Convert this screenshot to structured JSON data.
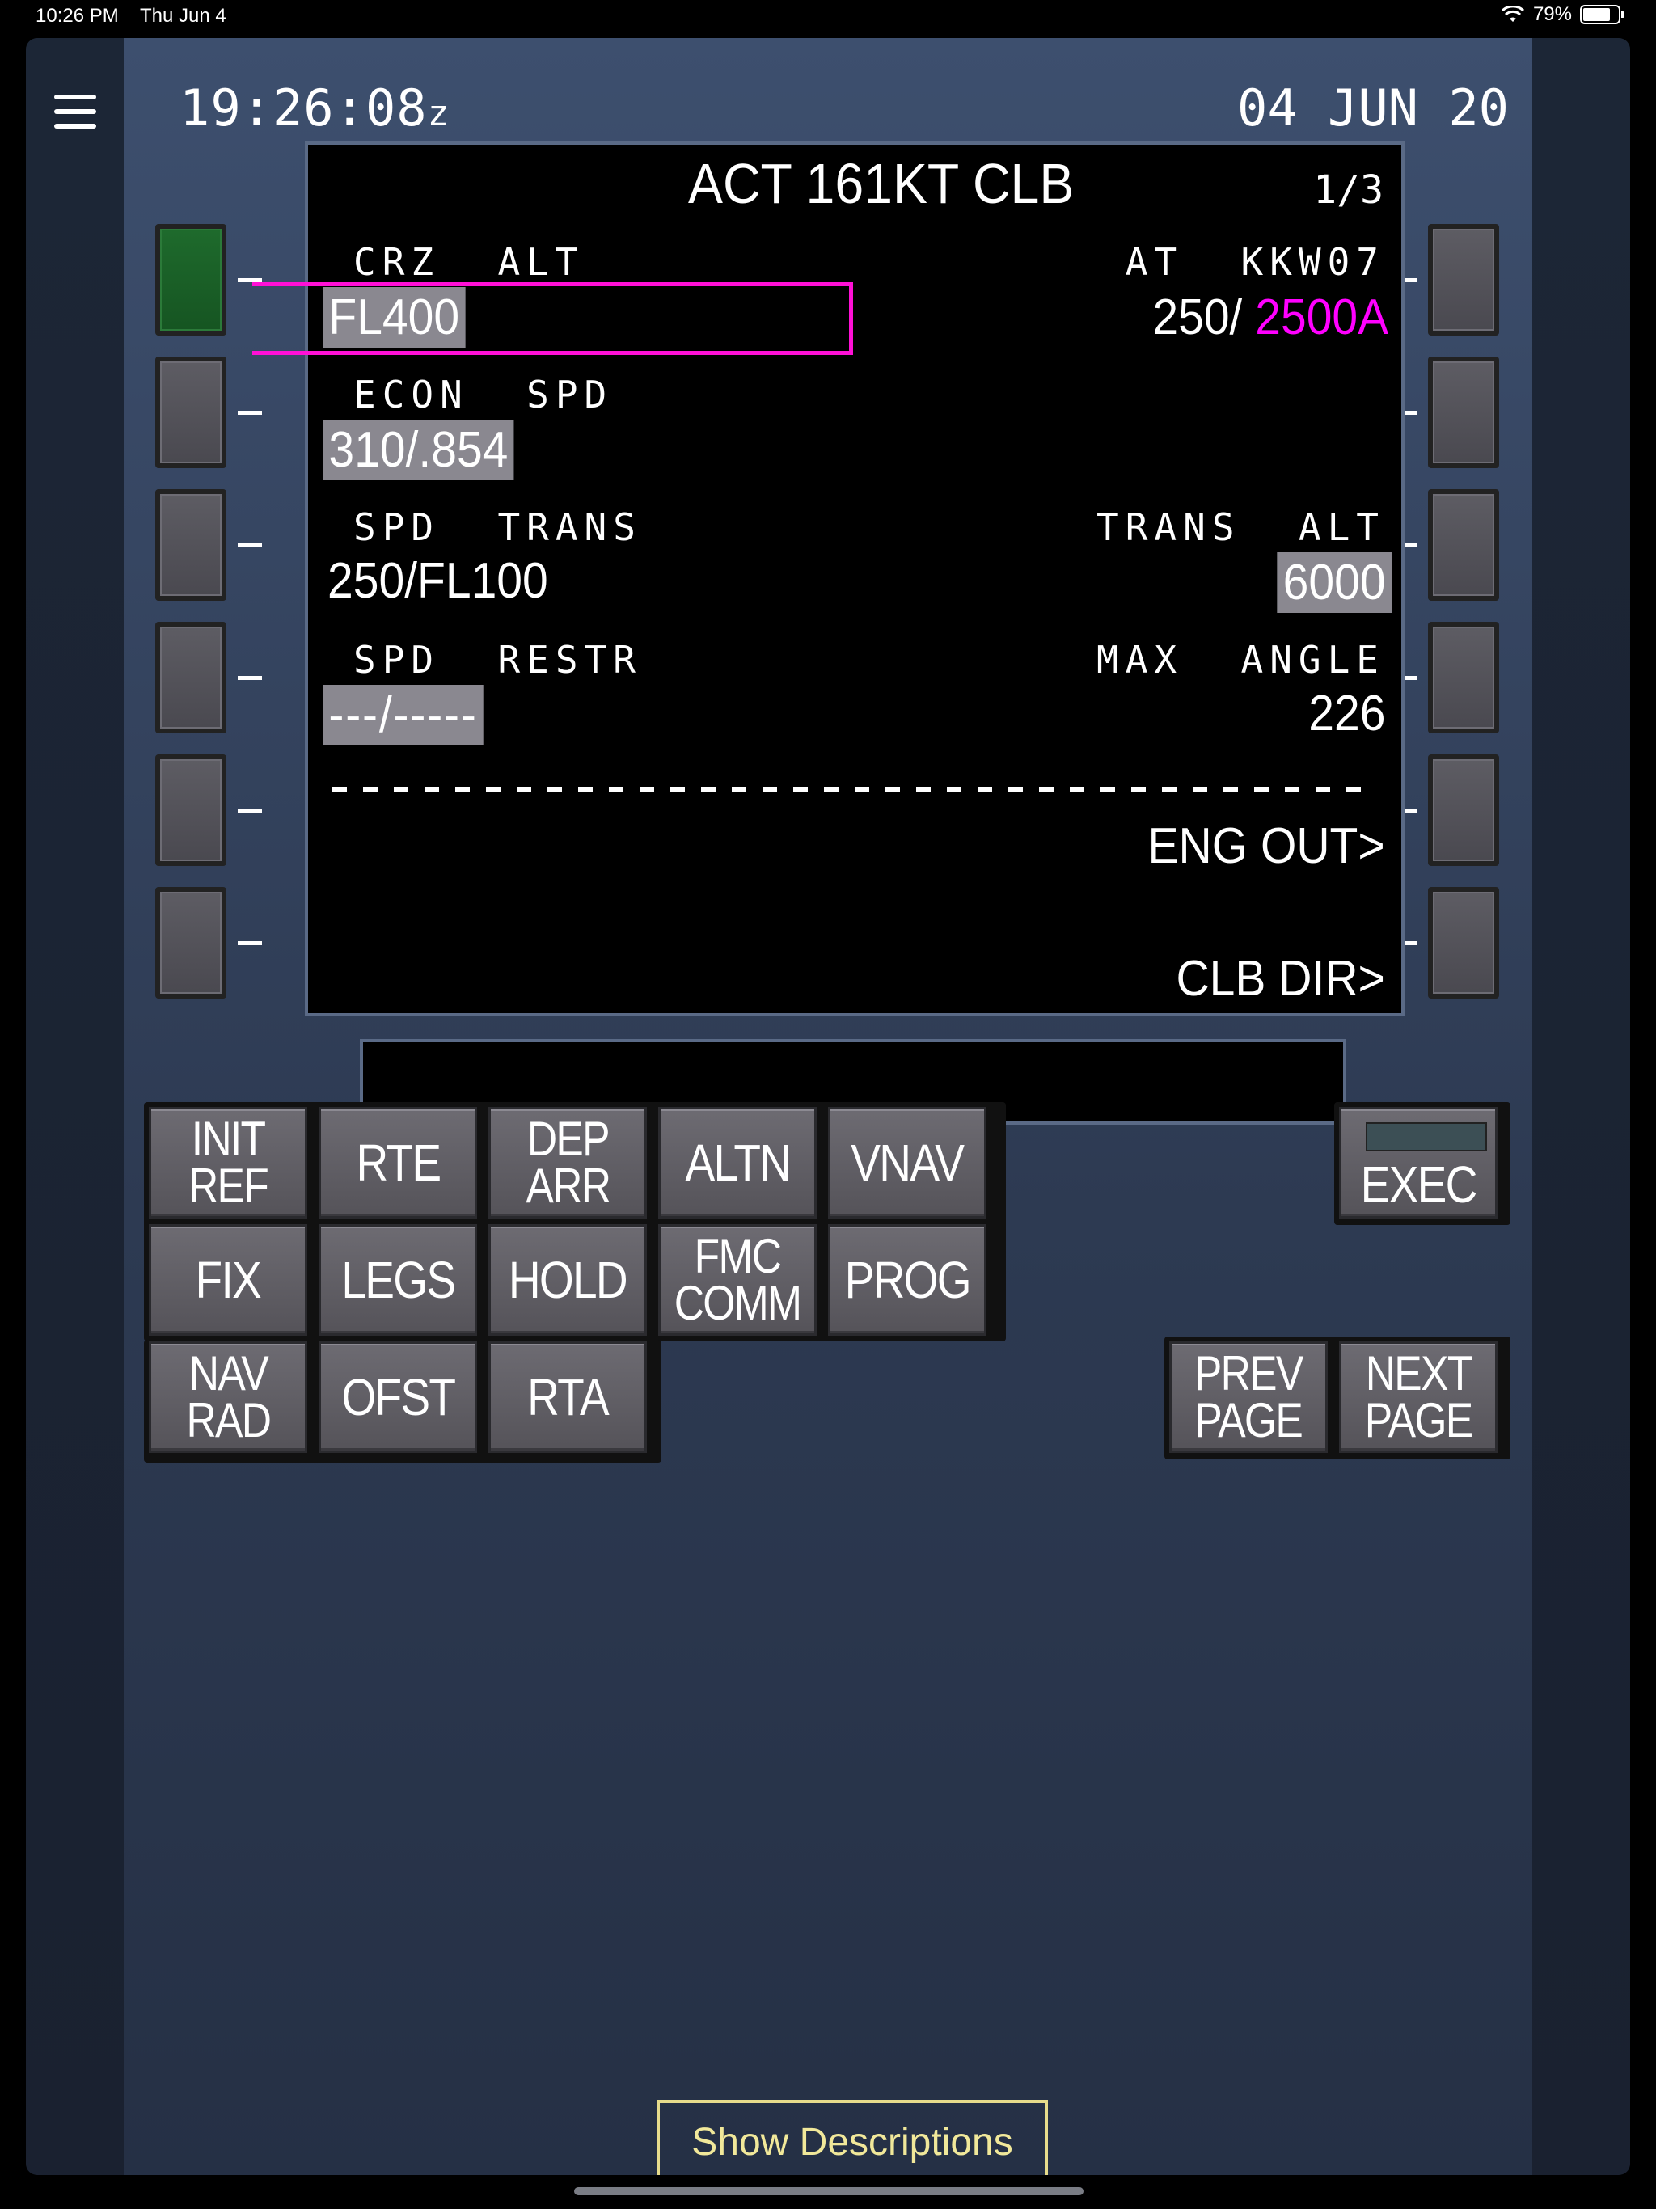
{
  "status_bar": {
    "time": "10:26 PM",
    "date": "Thu Jun 4",
    "battery": "79%",
    "battery_level": 0.79
  },
  "header": {
    "clock": "19:26:08",
    "clock_suffix": "z",
    "date": "04 JUN 20"
  },
  "cdu": {
    "title": "ACT 161KT CLB",
    "page": "1/3",
    "l1_label": "CRZ  ALT",
    "l1_value": "FL400",
    "r1_label": "AT  KKW07",
    "r1_value_white": "250/",
    "r1_value_magenta": "2500A",
    "l2_label": "ECON  SPD",
    "l2_value": "310/.854",
    "l3_label": "SPD  TRANS",
    "l3_value": "250/FL100",
    "r3_label": "TRANS  ALT",
    "r3_value": "6000",
    "l4_label": "SPD  RESTR",
    "l4_value": "---/-----",
    "r4_label": "MAX  ANGLE",
    "r4_value": "226",
    "r5_value": "ENG OUT>",
    "r6_value": "CLB DIR>"
  },
  "keys": {
    "init_ref": "INIT\nREF",
    "rte": "RTE",
    "dep_arr": "DEP\nARR",
    "altn": "ALTN",
    "vnav": "VNAV",
    "fix": "FIX",
    "legs": "LEGS",
    "hold": "HOLD",
    "fmc_comm": "FMC\nCOMM",
    "prog": "PROG",
    "nav_rad": "NAV\nRAD",
    "ofst": "OFST",
    "rta": "RTA",
    "exec": "EXEC",
    "prev_page": "PREV\nPAGE",
    "next_page": "NEXT\nPAGE"
  },
  "show_descriptions": "Show Descriptions",
  "colors": {
    "magenta": "#ff00ff",
    "active_lsk": "#1e6a2c",
    "panel": "#3d4f6e"
  }
}
